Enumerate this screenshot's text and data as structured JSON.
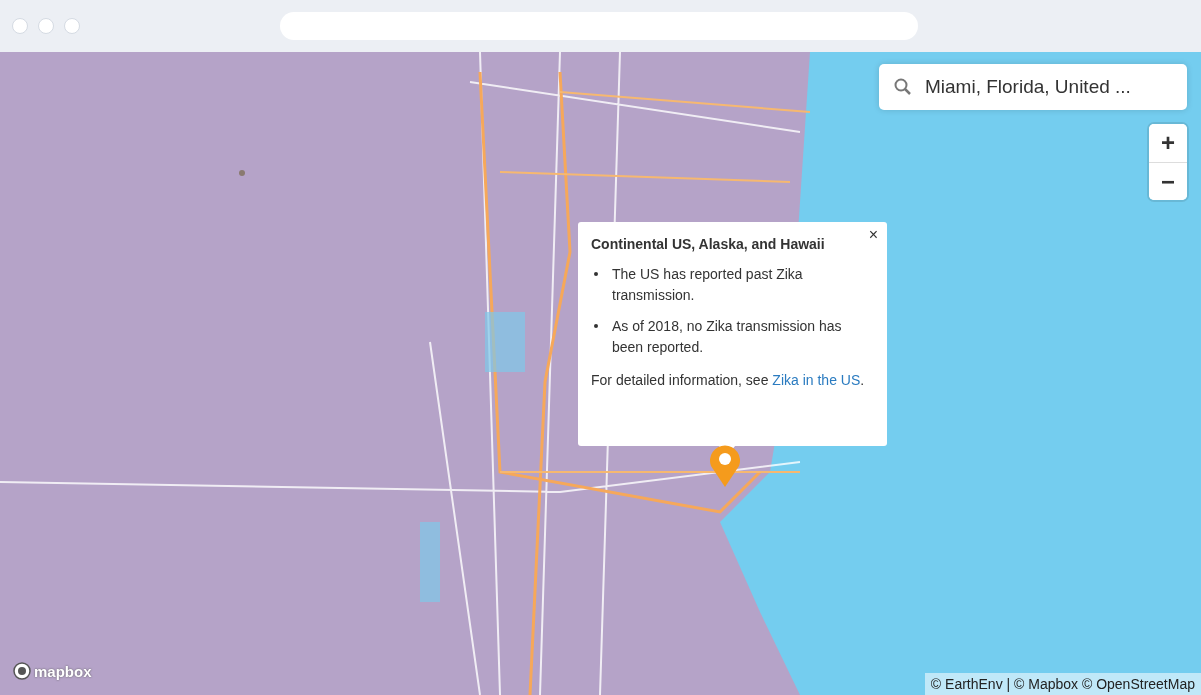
{
  "search": {
    "value": "Miami, Florida, United ..."
  },
  "zoom_controls": {
    "zoom_in": "+",
    "zoom_out": "−"
  },
  "popup": {
    "close": "×",
    "title": "Continental US, Alaska, and Hawaii",
    "bullets": [
      "The US has reported past Zika transmission.",
      "As of 2018, no Zika transmission has been reported."
    ],
    "footer": {
      "text": "For detailed information, see ",
      "link": "Zika in the US",
      "after": "."
    }
  },
  "logo": "mapbox",
  "attribution": "© EarthEnv | © Mapbox © OpenStreetMap"
}
